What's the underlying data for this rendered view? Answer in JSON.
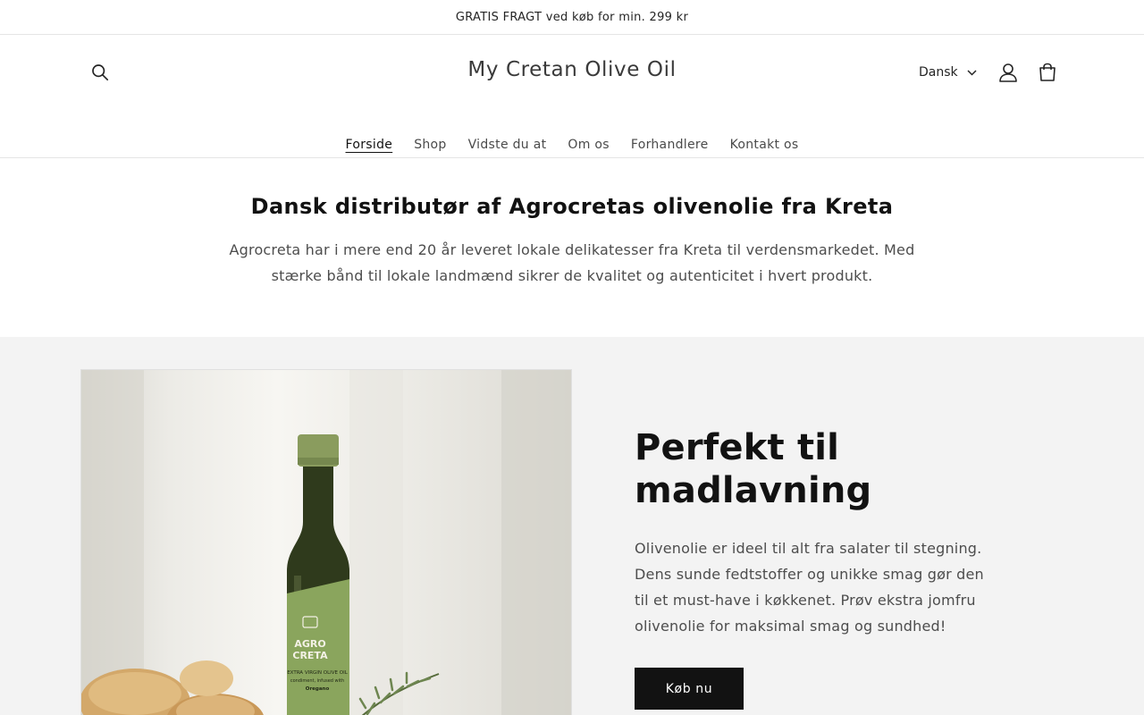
{
  "announcement": {
    "text": "GRATIS FRAGT ved køb for min. 299 kr"
  },
  "header": {
    "site_title": "My Cretan Olive Oil",
    "language": {
      "selected": "Dansk"
    },
    "icons": {
      "search": "search-icon",
      "account": "account-icon",
      "cart": "cart-icon"
    }
  },
  "nav": {
    "items": [
      {
        "label": "Forside",
        "active": true
      },
      {
        "label": "Shop",
        "active": false
      },
      {
        "label": "Vidste du at",
        "active": false
      },
      {
        "label": "Om os",
        "active": false
      },
      {
        "label": "Forhandlere",
        "active": false
      },
      {
        "label": "Kontakt os",
        "active": false
      }
    ]
  },
  "intro": {
    "heading": "Dansk distributør af Agrocretas olivenolie fra Kreta",
    "text": "Agrocreta har i mere end 20 år leveret lokale delikatesser fra Kreta til verdensmarkedet. Med stærke bånd til lokale landmænd sikrer de kvalitet og autenticitet i hvert produkt."
  },
  "feature": {
    "heading": "Perfekt til madlavning",
    "text": "Olivenolie er ideel til alt fra salater til stegning. Dens sunde fedtstoffer og unikke smag gør den til et must-have i køkkenet. Prøv ekstra jomfru olivenolie for maksimal smag og sundhed!",
    "button_label": "Køb nu",
    "image": {
      "bottle_label_line1": "AGRO",
      "bottle_label_line2": "CRETA",
      "bottle_label_line3": "EXTRA VIRGIN OLIVE OIL",
      "bottle_label_line4": "condiment, infused with",
      "bottle_label_line5": "Oregano"
    }
  },
  "colors": {
    "accent": "#121212",
    "section_bg": "#f3f3f3",
    "bottle_label": "#8aa55d"
  }
}
